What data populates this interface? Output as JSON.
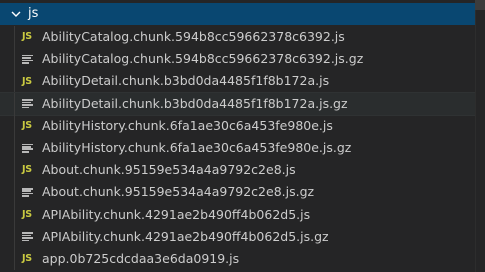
{
  "explorer": {
    "folder": {
      "label": "js",
      "icon": "chevron-down-icon",
      "expanded": true
    },
    "files": [
      {
        "name": "AbilityCatalog.chunk.594b8cc59662378c6392.js",
        "type": "js",
        "icon_label": "JS"
      },
      {
        "name": "AbilityCatalog.chunk.594b8cc59662378c6392.js.gz",
        "type": "gz"
      },
      {
        "name": "AbilityDetail.chunk.b3bd0da4485f1f8b172a.js",
        "type": "js",
        "icon_label": "JS"
      },
      {
        "name": "AbilityDetail.chunk.b3bd0da4485f1f8b172a.js.gz",
        "type": "gz",
        "hovered": true
      },
      {
        "name": "AbilityHistory.chunk.6fa1ae30c6a453fe980e.js",
        "type": "js",
        "icon_label": "JS"
      },
      {
        "name": "AbilityHistory.chunk.6fa1ae30c6a453fe980e.js.gz",
        "type": "gz"
      },
      {
        "name": "About.chunk.95159e534a4a9792c2e8.js",
        "type": "js",
        "icon_label": "JS"
      },
      {
        "name": "About.chunk.95159e534a4a9792c2e8.js.gz",
        "type": "gz"
      },
      {
        "name": "APIAbility.chunk.4291ae2b490ff4b062d5.js",
        "type": "js",
        "icon_label": "JS"
      },
      {
        "name": "APIAbility.chunk.4291ae2b490ff4b062d5.js.gz",
        "type": "gz"
      },
      {
        "name": "app.0b725cdcdaa3e6da0919.js",
        "type": "js",
        "icon_label": "JS"
      }
    ],
    "colors": {
      "background": "#252526",
      "selected_folder": "#094771",
      "js_icon": "#cbcb41",
      "text": "#cccccc"
    }
  }
}
